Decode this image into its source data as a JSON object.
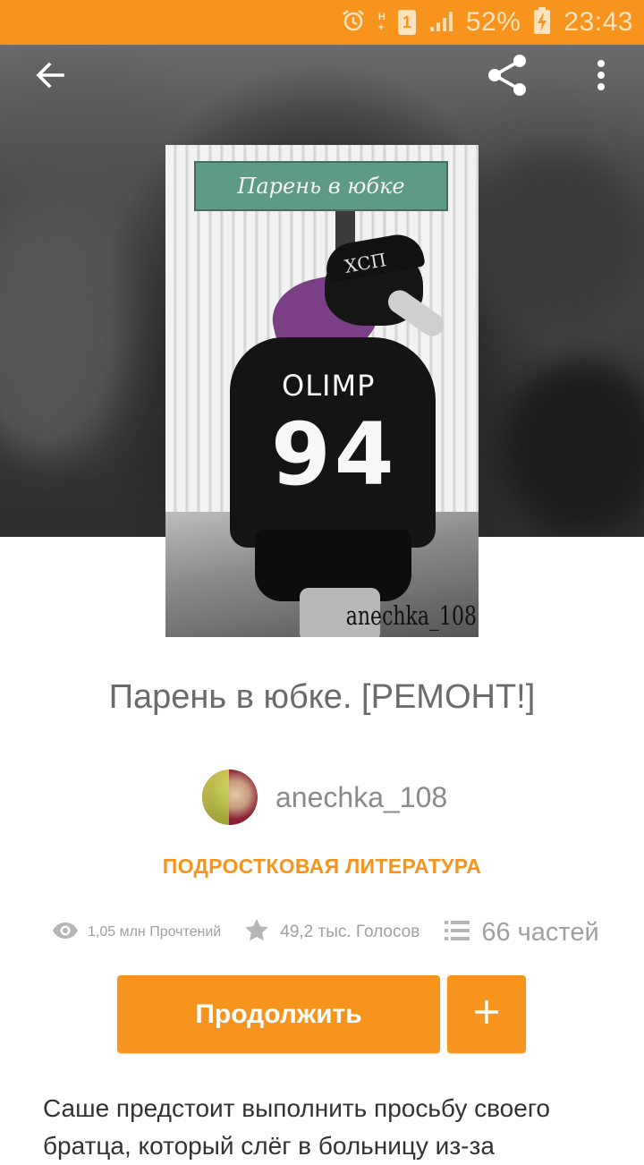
{
  "status_bar": {
    "alarm_icon": "alarm-clock-icon",
    "network_type": "H+",
    "sim_slot": "1",
    "battery_percent": "52%",
    "time": "23:43"
  },
  "toolbar": {
    "back_icon": "arrow-back-icon",
    "share_icon": "share-icon",
    "more_icon": "more-vertical-icon"
  },
  "cover": {
    "sign_text": "Парень в юбке",
    "cap_text": "ХСП",
    "shirt_text": "OLIMP",
    "shirt_number": "94",
    "author_mark": "anechka_108"
  },
  "story": {
    "title": "Парень в юбке. [РЕМОНТ!]",
    "author": "anechka_108",
    "category": "ПОДРОСТКОВАЯ ЛИТЕРАТУРА",
    "stats": {
      "reads": "1,05 млн Прочтений",
      "votes": "49,2 тыс. Голосов",
      "parts": "66 частей"
    },
    "description": "Саше предстоит выполнить просьбу своего братца, который слёг в больницу из-за"
  },
  "actions": {
    "continue_label": "Продолжить",
    "add_label": "+"
  },
  "colors": {
    "accent": "#f7941d",
    "title_text": "#6b6b6b",
    "muted_text": "#a0a0a0"
  }
}
